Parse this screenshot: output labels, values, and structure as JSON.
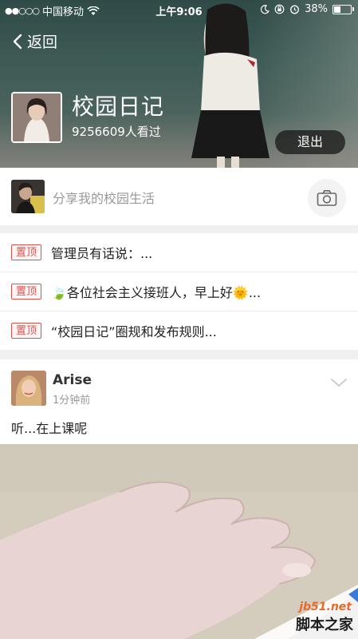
{
  "status_bar": {
    "signal": "●●○○○",
    "carrier": "中国移动",
    "time": "上午9:06",
    "battery": "38%",
    "battery_level": 0.38
  },
  "header": {
    "back_label": "返回",
    "group_title": "校园日记",
    "views": "9256609人看过",
    "exit_label": "退出"
  },
  "composer": {
    "placeholder": "分享我的校园生活"
  },
  "pinned": {
    "tag": "置顶",
    "items": [
      {
        "text": "管理员有话说：..."
      },
      {
        "text": "🍃各位社会主义接班人，早上好🌞..."
      },
      {
        "text": "“校园日记”圈规和发布规则..."
      }
    ]
  },
  "post": {
    "author": "Arise",
    "time": "1分钟前",
    "content": "听...在上课呢"
  },
  "watermark": {
    "site": "jb51.net",
    "name": "脚本之家"
  },
  "colors": {
    "pin_tag": "#d9534f",
    "watermark_site": "#e8692a"
  }
}
